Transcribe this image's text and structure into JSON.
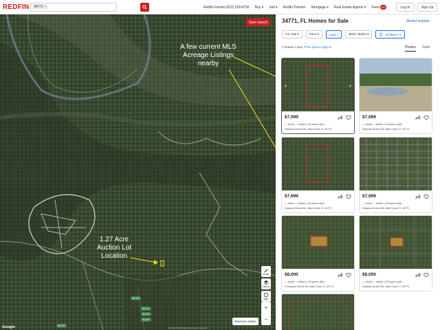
{
  "header": {
    "logo": "REDFIN",
    "search_chip": "34771",
    "nav": [
      {
        "label": "Redfin Florida (813) 518-6756"
      },
      {
        "label": "Buy ▾"
      },
      {
        "label": "Sell ▾"
      },
      {
        "label": "Redfin Premier"
      },
      {
        "label": "Mortgage ▾"
      },
      {
        "label": "Real Estate Agents ▾"
      },
      {
        "label": "Feed"
      }
    ],
    "feed_badge": "14",
    "login": "Log In",
    "signup": "Sign Up"
  },
  "map": {
    "save_search": "Save search",
    "draw": "Draw",
    "options": "Options",
    "map_btn": "Map",
    "zoom_in": "+",
    "zoom_out": "−",
    "remove_outline": "Remove outline",
    "price_labels": [
      "$8,000",
      "$8,000",
      "$8,000",
      "$8,000",
      "$8,000"
    ],
    "google": "Google",
    "attribution": "Map data ©2023 Google  Terms  Report a map error",
    "annotation_mls": "A few current MLS Acreage Listings nearby",
    "annotation_lot": "1.27 Acre Auction Lot Location"
  },
  "results": {
    "title": "34771, FL Homes for Sale",
    "market_insights": "Market insights",
    "filters": [
      {
        "label": "For sale ▾",
        "active": false
      },
      {
        "label": "Price ▾",
        "active": false
      },
      {
        "label": "Land  ×",
        "active": true
      },
      {
        "label": "Beds / Baths ▾",
        "active": false
      },
      {
        "label": "All filters • 1",
        "active": true
      }
    ],
    "count": "7 homes",
    "sort_label": "Sort:",
    "sort_value": "Price (low to high) ▾",
    "tabs": [
      "Photos",
      "Table"
    ],
    "listings": [
      {
        "price": "$7,999",
        "facts": "— beds  — baths  1.26 acres (lot)",
        "address": "Holopaw Groves Rd, Saint Cloud, FL 34773"
      },
      {
        "price": "$7,999",
        "facts": "— beds  — baths  1.26 acres (lot)",
        "address": "Holopaw Groves Rd, Saint Cloud, FL 34773"
      },
      {
        "price": "$7,999",
        "facts": "— beds  — baths  1.26 acres (lot)",
        "address": "Holopaw Groves Rd, Saint Cloud, FL 34773"
      },
      {
        "price": "$7,999",
        "facts": "— beds  — baths  1.26 acres (lot)",
        "address": "Holopaw Groves Rd, Saint Cloud, FL 34773"
      },
      {
        "price": "$8,000",
        "facts": "— beds  — baths  1.29 acres (lot)",
        "address": "0 Holopaw Groves Rd, Saint Cloud, FL 34773"
      },
      {
        "price": "$8,000",
        "facts": "— beds  — baths  1.25 acres (lot)",
        "address": "Holopaw Groves Rd, Saint Cloud, FL 34773"
      }
    ]
  },
  "colors": {
    "brand": "#c82021",
    "link": "#1a6cd1",
    "annotation": "#f4e419"
  }
}
